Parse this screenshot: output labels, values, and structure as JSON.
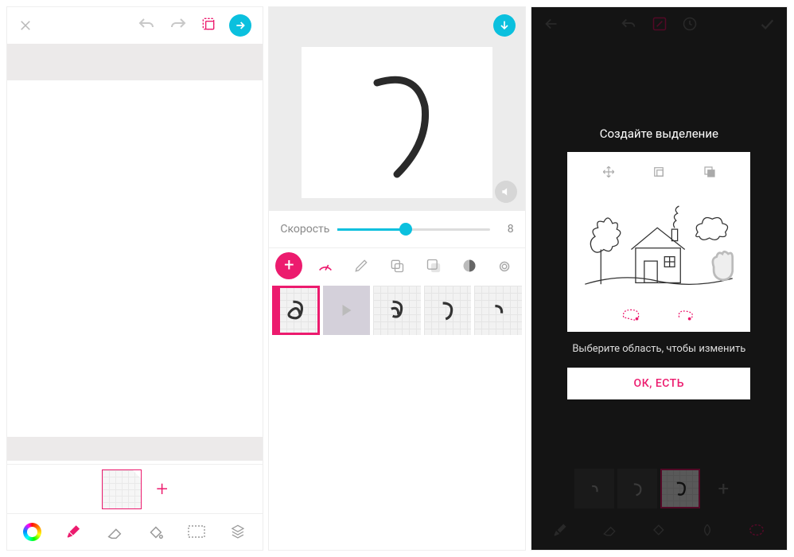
{
  "panel1": {
    "top_icons": {
      "close": "close-icon",
      "undo": "undo-icon",
      "redo": "redo-icon",
      "crop": "crop-dashed-icon",
      "next": "arrow-right-icon"
    },
    "thumb": {
      "add_label": "+"
    },
    "bottom_tools": [
      "color-ring-icon",
      "brush-icon",
      "eraser-icon",
      "bucket-icon",
      "lasso-icon",
      "layers-icon"
    ]
  },
  "panel2": {
    "download_icon": "arrow-down-icon",
    "speed": {
      "label": "Скорость",
      "value": "8"
    },
    "toolbar": [
      "add",
      "speedometer",
      "pencil",
      "copy",
      "crop-mask",
      "onion",
      "snail"
    ],
    "frames": [
      {
        "selected": true,
        "glyph": "loop"
      },
      {
        "play": true
      },
      {
        "glyph": "half-loop"
      },
      {
        "glyph": "arc"
      },
      {
        "glyph": "small-arc"
      }
    ]
  },
  "panel3": {
    "top_icons": [
      "back",
      "undo",
      "edit-box",
      "help",
      "check"
    ],
    "dialog": {
      "title": "Создайте выделение",
      "subtitle": "Выберите область, чтобы изменить",
      "button_label": "ОК, ЕСТЬ",
      "tool_icons": [
        "move-icon",
        "crop-icon",
        "invert-icon"
      ]
    },
    "thumbs": [
      {
        "glyph": "small-arc"
      },
      {
        "glyph": "arc"
      },
      {
        "glyph": "loop",
        "selected": true
      },
      {
        "plus": true
      }
    ],
    "bottom_tools": [
      "brush-icon",
      "eraser-icon",
      "bucket-icon",
      "invert-mask-icon",
      "lasso-dashed-icon"
    ]
  }
}
